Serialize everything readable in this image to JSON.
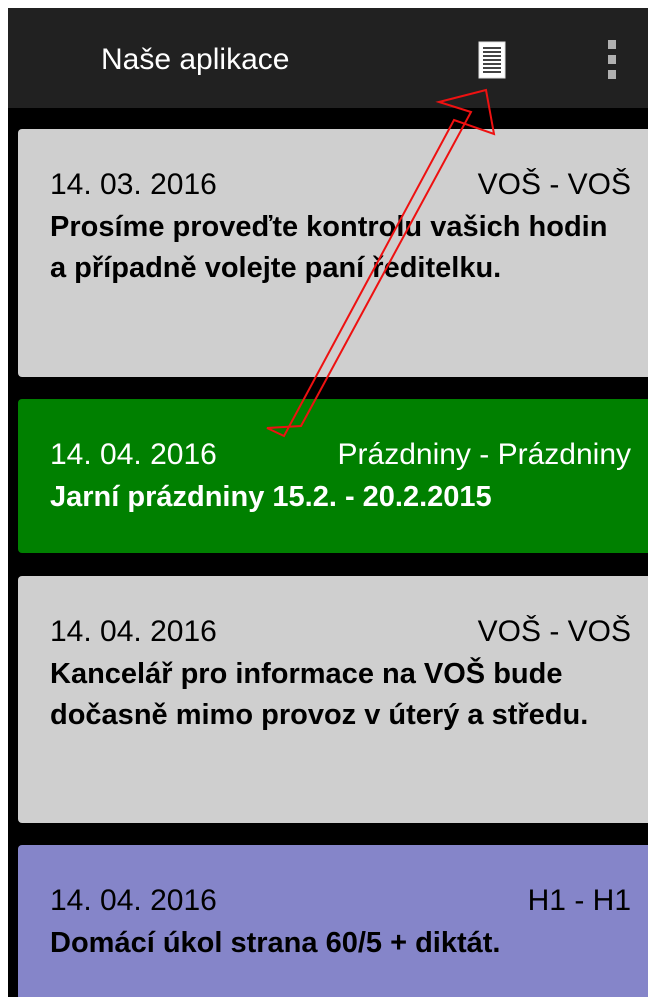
{
  "app": {
    "title": "Naše aplikace",
    "list_icon": "list-icon",
    "overflow_icon": "overflow-menu-icon"
  },
  "colors": {
    "action_bar": "#212121",
    "background": "#000000",
    "card_gray": "#cfcfcf",
    "card_green": "#008000",
    "card_purple": "#8585c9",
    "annotation_arrow": "#ee1111"
  },
  "cards": [
    {
      "date": "14. 03. 2016",
      "group": "VOŠ - VOŠ",
      "message": "Prosíme proveďte kontrolu vašich hodin a případně volejte paní ředitelku.",
      "color": "#cfcfcf",
      "text_color": "#000000"
    },
    {
      "date": "14. 04. 2016",
      "group": "Prázdniny - Prázdniny",
      "message": "Jarní prázdniny 15.2. - 20.2.2015",
      "color": "#008000",
      "text_color": "#ffffff"
    },
    {
      "date": "14. 04. 2016",
      "group": "VOŠ - VOŠ",
      "message": "Kancelář pro informace na VOŠ bude dočasně mimo provoz v úterý a středu.",
      "color": "#cfcfcf",
      "text_color": "#000000"
    },
    {
      "date": "14. 04. 2016",
      "group": "H1 - H1",
      "message": "Domácí úkol strana 60/5 + diktát.",
      "color": "#8585c9",
      "text_color": "#000000"
    }
  ]
}
